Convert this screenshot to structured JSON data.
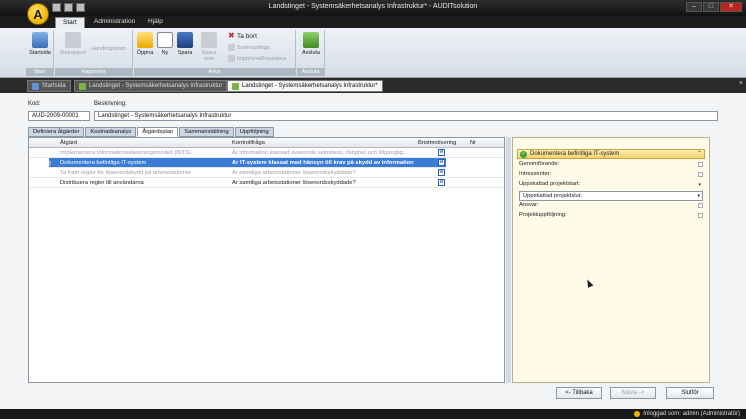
{
  "window": {
    "title": "Landstinget - Systemsäkerhetsanalys Infrastruktur* - AUDITsolution",
    "logo_letter": "A"
  },
  "menu_tabs": [
    "Start",
    "Administration",
    "Hjälp"
  ],
  "ribbon": {
    "startsida": "Startsida",
    "slutrapport": "Slutrapport",
    "handlingsplan": "Handlingsplan",
    "oppna": "Öppna",
    "ny": "Ny",
    "spara": "Spara",
    "spara_som": "Spara som",
    "ta_bort": "Ta bort",
    "sammanfoga": "Sammanfoga",
    "importera": "Importera/Exportera",
    "avsluta": "Avsluta",
    "group_start": "Start",
    "group_rapporter": "Rapporter",
    "group_arkiv": "Arkiv",
    "group_avsluta": "Avsluta"
  },
  "doc_tabs": [
    "Startsida",
    "Landstinget - Systemsäkerhetsanalys Infrastruktur",
    "Landstinget - Systemsäkerhetsanalys Infrastruktur*"
  ],
  "form": {
    "kod_label": "Kod:",
    "kod_value": "AUD-2009-00001",
    "beskrivning_label": "Beskrivning:",
    "beskrivning_value": "Landstinget - Systemsäkerhetsanalys Infrastruktur"
  },
  "sub_tabs": [
    "Definiera åtgärder",
    "Kostnadsanalys",
    "Åtgärdsplan",
    "Sammanställning",
    "Uppföljning"
  ],
  "grid": {
    "headers": [
      "Åtgärd",
      "Kontrollfråga",
      "Bristmotivering",
      "Nr"
    ],
    "rows": [
      {
        "atgard": "Implementera informationsklassningsmodell (BITS)",
        "fraga": "Är information klassad avseende sekretess, riktighet och tillgänglig...",
        "ikon": "A"
      },
      {
        "atgard": "Dokumentera befintliga IT-system",
        "fraga": "Är IT-system klassat med hänsyn till krav på skydd av informatione...",
        "ikon": "A"
      },
      {
        "atgard": "Ta fram regler för lösenordskydd på arbetsstationer",
        "fraga": "Är samtliga arbetsstationer lösenordsskyddade?",
        "ikon": "A"
      },
      {
        "atgard": "Distribuera regler till användarna",
        "fraga": "Är samtliga arbetsstationer lösenordsskyddade?",
        "ikon": "A"
      }
    ]
  },
  "detail": {
    "title": "Dokumentera befintliga IT-system",
    "genomforande": "Genomförande:",
    "intressenter": "Intressenter:",
    "start": "Uppskattad projektstart:",
    "slut": "Uppskattad projektslut:",
    "ansvar": "Ansvar:",
    "uppfoljning": "Projektuppföljning:"
  },
  "buttons": {
    "tillbaka": "<- Tillbaka",
    "nasta": "Nästa ->",
    "slutfor": "Slutför"
  },
  "status": {
    "text": "Inloggad som: admin (Administratör)"
  },
  "colors": {
    "selected_row": "#3a7bd5",
    "detail_bg": "#fffbe8",
    "accent": "#f0b400"
  }
}
